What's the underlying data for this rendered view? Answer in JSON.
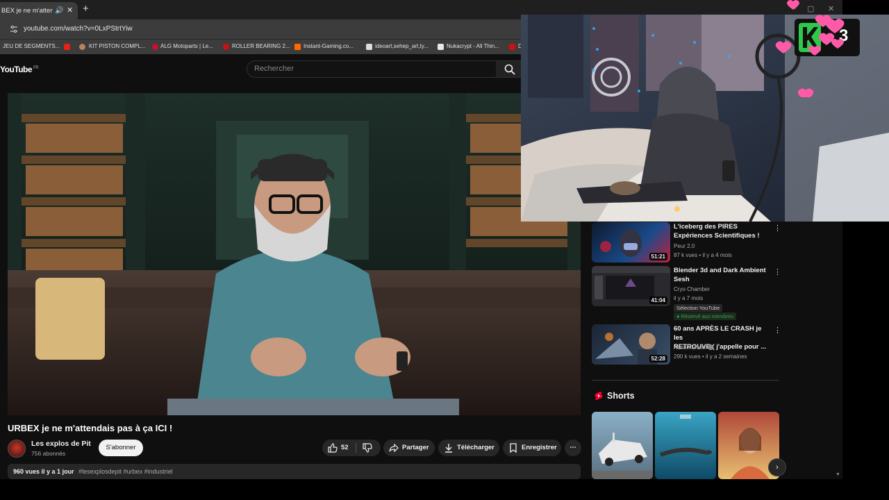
{
  "browser": {
    "tab": {
      "title": "URBEX je ne m'attendais pas à ça ICI !",
      "visible_title": "BEX je ne m'attendai",
      "close": "✕",
      "sound": "🔊"
    },
    "new_tab": "+",
    "window_controls": {
      "minimize": "–",
      "maximize": "▢",
      "close": "✕"
    },
    "url": "youtube.com/watch?v=0LxPStrtYiw",
    "bookmarks": [
      {
        "label": "JEU DE SEGMENTS..."
      },
      {
        "label": "KIT PISTON COMPL..."
      },
      {
        "label": "ALG Motoparts | Le..."
      },
      {
        "label": "ROLLER BEARING 2..."
      },
      {
        "label": "Instant-Gaming.co..."
      },
      {
        "label": "ideoart,sehep_art,ty..."
      },
      {
        "label": "Nukacrypt - All Thin..."
      },
      {
        "label": "D"
      }
    ]
  },
  "youtube": {
    "logo": "YouTube",
    "logo_region": "FR",
    "search_placeholder": "Rechercher",
    "video": {
      "title": "URBEX je ne m'attendais pas à ça ICI !",
      "channel": "Les explos de Pit",
      "subscribers": "756 abonnés",
      "subscribe_label": "S'abonner",
      "likes": "52",
      "share_label": "Partager",
      "download_label": "Télécharger",
      "save_label": "Enregistrer",
      "more": "⋯",
      "views": "960 vues",
      "age": "il y a 1 jour",
      "tags": "#lesexplosdepit #urbex #industriel"
    },
    "recommendations": [
      {
        "title": "L'iceberg des PIRES Expériences Scientifiques !",
        "visible_title_line1": "L'iceberg des PIRES",
        "visible_title_line2": "Expériences Scientifiques !",
        "channel": "Peur 2.0",
        "meta": "87 k vues • il y a 4 mois",
        "duration": "51:21",
        "accent": "#1a4a8a"
      },
      {
        "title": "Blender 3d and Dark Ambient Sesh",
        "visible_title_line1": "Blender 3d and Dark Ambient",
        "visible_title_line2": "Sesh",
        "channel": "Cryo Chamber",
        "meta": "il y a 7 mois",
        "duration": "41:04",
        "badge": "Sélection YouTube",
        "member": "Réservé aux membres",
        "accent": "#3a3a3a"
      },
      {
        "title": "60 ans APRÈS LE CRASH je les RETROUVE ( j'appelle pour ...",
        "visible_title_line1": "60 ans APRÈS LE CRASH je les",
        "visible_title_line2": "RETROUVE ( j'appelle pour ...",
        "channel": "Adrien Urbex",
        "meta": "290 k vues • il y a 2 semaines",
        "duration": "52:28",
        "accent": "#3a4e66"
      }
    ],
    "shorts_heading": "Shorts",
    "shorts_next": "›"
  },
  "overlay": {
    "logo_digit": "3"
  },
  "colors": {
    "youtube_red": "#ff0000",
    "page_bg": "#0f0f0f",
    "chip_bg": "#272727",
    "member_green": "#2ba640",
    "heart_pink": "#ff5aa8"
  }
}
